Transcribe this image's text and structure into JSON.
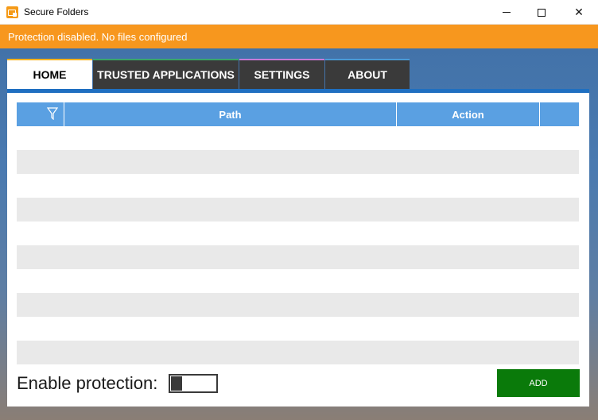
{
  "window": {
    "title": "Secure Folders",
    "controls": {
      "minimize": "",
      "maximize": "",
      "close": "✕"
    }
  },
  "status": {
    "message": "Protection disabled. No files configured",
    "color": "#f7971e"
  },
  "tabs": [
    {
      "label": "HOME",
      "active": true,
      "accent": "#f7b21e"
    },
    {
      "label": "TRUSTED APPLICATIONS",
      "active": false,
      "accent": "#3aa66a"
    },
    {
      "label": "SETTINGS",
      "active": false,
      "accent": "#c77ad6"
    },
    {
      "label": "ABOUT",
      "active": false,
      "accent": "#4a9ad6"
    }
  ],
  "table": {
    "columns": [
      "",
      "Path",
      "Action",
      ""
    ],
    "filter_icon": "filter-icon",
    "header_color": "#5aa0e2",
    "rows": []
  },
  "footer": {
    "protection_label": "Enable protection:",
    "protection_enabled": false,
    "add_label": "ADD",
    "add_color": "#0a7a0a"
  }
}
